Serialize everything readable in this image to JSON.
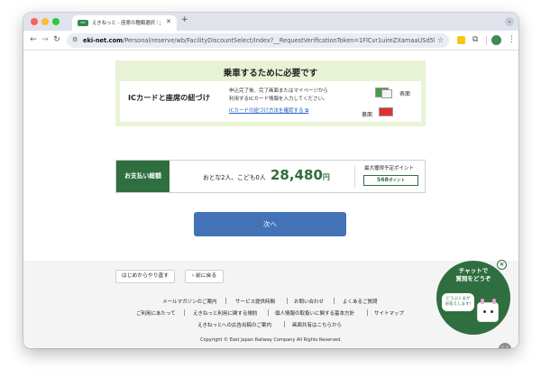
{
  "browser": {
    "tab_title": "えきねっと - 座席の種類選択｜JR東日本",
    "tab_favicon_text": "eki",
    "new_tab": "+",
    "url_domain": "eki-net.com",
    "url_path": "/Personal/reserve/wb/FacilityDiscountSelect/Index?__RequestVerificationToken=1FlCvr1uireZXamaaUSd5lY8Et7QxJd...",
    "icons": {
      "back": "arrow-left-icon",
      "forward": "arrow-right-icon",
      "reload": "reload-icon",
      "site_info": "tune-icon",
      "bookmark": "star-icon",
      "extension": "puzzle-icon",
      "menu": "kebab-icon"
    },
    "traffic_colors": [
      "#ff5f57",
      "#febc2e",
      "#28c840"
    ]
  },
  "requirement": {
    "title": "乗車するために必要です",
    "ic_label": "ICカードと座席の紐づけ",
    "desc_line1": "申込完了後、完了画面またはマイページから",
    "desc_line2": "利用するICカード情報を入力してください。",
    "link": "ICカードの紐づけ方法を確認する",
    "front_label": "表面",
    "back_label": "裏面"
  },
  "payment": {
    "label": "お支払い総額",
    "passengers": "おとな2人、こども0人",
    "amount": "28,480",
    "currency": "円",
    "points_label": "最大獲得予定ポイント",
    "points": "568",
    "points_unit": "ポイント"
  },
  "next_button": "次へ",
  "footer": {
    "restart_button": "はじめからやり直す",
    "back_button": "前に戻る",
    "row1": [
      "メールマガジンのご案内",
      "サービス提供時間",
      "お問い合わせ",
      "よくあるご質問"
    ],
    "row2": [
      "ご利用にあたって",
      "えきねっと利用に関する規約",
      "個人情報の取扱いに関する基本方針",
      "サイトマップ"
    ],
    "row3": [
      "えきねっとへの広告出稿のご案内",
      "画面共有はこちらから"
    ],
    "copyright": "Copyright © East Japan Railway Company All Rights Reserved."
  },
  "chat": {
    "line1": "チャットで",
    "line2": "質問をどうぞ",
    "bubble_line1": "どうぶくまが",
    "bubble_line2": "お答えします!",
    "close": "×"
  },
  "colors": {
    "brand_green": "#2f6e3e",
    "next_blue": "#4373b6",
    "req_bg": "#e8f3d6",
    "link_blue": "#1a5dc6"
  }
}
